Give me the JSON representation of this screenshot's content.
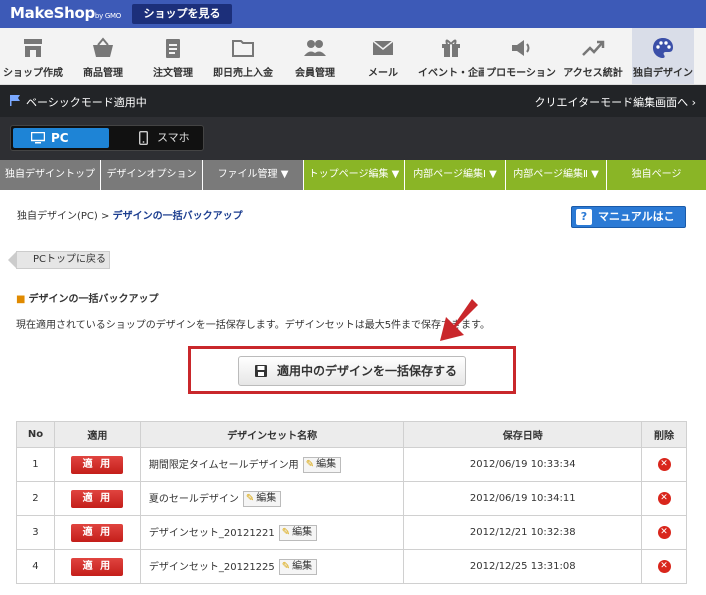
{
  "header": {
    "logo": "MakeShop",
    "logo_sub": "by GMO",
    "view_shop_label": "ショップを見る"
  },
  "main_nav": [
    {
      "label": "ショップ作成",
      "icon": "shop-icon"
    },
    {
      "label": "商品管理",
      "icon": "basket-icon"
    },
    {
      "label": "注文管理",
      "icon": "clipboard-icon"
    },
    {
      "label": "即日売上入金",
      "icon": "folder-icon"
    },
    {
      "label": "会員管理",
      "icon": "users-icon"
    },
    {
      "label": "メール",
      "icon": "mail-icon"
    },
    {
      "label": "イベント・企画",
      "icon": "gift-icon"
    },
    {
      "label": "プロモーション",
      "icon": "megaphone-icon"
    },
    {
      "label": "アクセス統計",
      "icon": "trend-icon"
    },
    {
      "label": "独自デザイン",
      "icon": "palette-icon"
    }
  ],
  "mode_bar": {
    "basic_mode": "ベーシックモード適用中",
    "creator_link": "クリエイターモード編集画面へ ›"
  },
  "device": {
    "pc": "PC",
    "smartphone": "スマホ"
  },
  "sub_nav": [
    "独自デザイントップ",
    "デザインオプション",
    "ファイル管理 ▼",
    "トップページ編集 ▼",
    "内部ページ編集Ⅰ ▼",
    "内部ページ編集Ⅱ ▼",
    "独自ページ"
  ],
  "breadcrumb": {
    "parent": "独自デザイン(PC)",
    "sep": " > ",
    "current": "デザインの一括バックアップ"
  },
  "manual_label": "マニュアルはこちら",
  "back_label": "PCトップに戻る",
  "section_title": "デザインの一括バックアップ",
  "description": "現在適用されているショップのデザインを一括保存します。デザインセットは最大5件まで保存できます。",
  "save_button_label": "適用中のデザインを一括保存する",
  "table": {
    "headers": [
      "No",
      "適用",
      "デザインセット名称",
      "保存日時",
      "削除"
    ],
    "apply_label": "適 用",
    "edit_label": "編集",
    "rows": [
      {
        "no": "1",
        "name": "期間限定タイムセールデザイン用",
        "date": "2012/06/19 10:33:34"
      },
      {
        "no": "2",
        "name": "夏のセールデザイン",
        "date": "2012/06/19 10:34:11"
      },
      {
        "no": "3",
        "name": "デザインセット_20121221",
        "date": "2012/12/21 10:32:38"
      },
      {
        "no": "4",
        "name": "デザインセット_20121225",
        "date": "2012/12/25 13:31:08"
      }
    ]
  },
  "colors": {
    "header_blue": "#3d5ab7",
    "accent_green": "#8ab526",
    "highlight_red": "#c9272b",
    "pc_blue": "#1e84d6"
  }
}
